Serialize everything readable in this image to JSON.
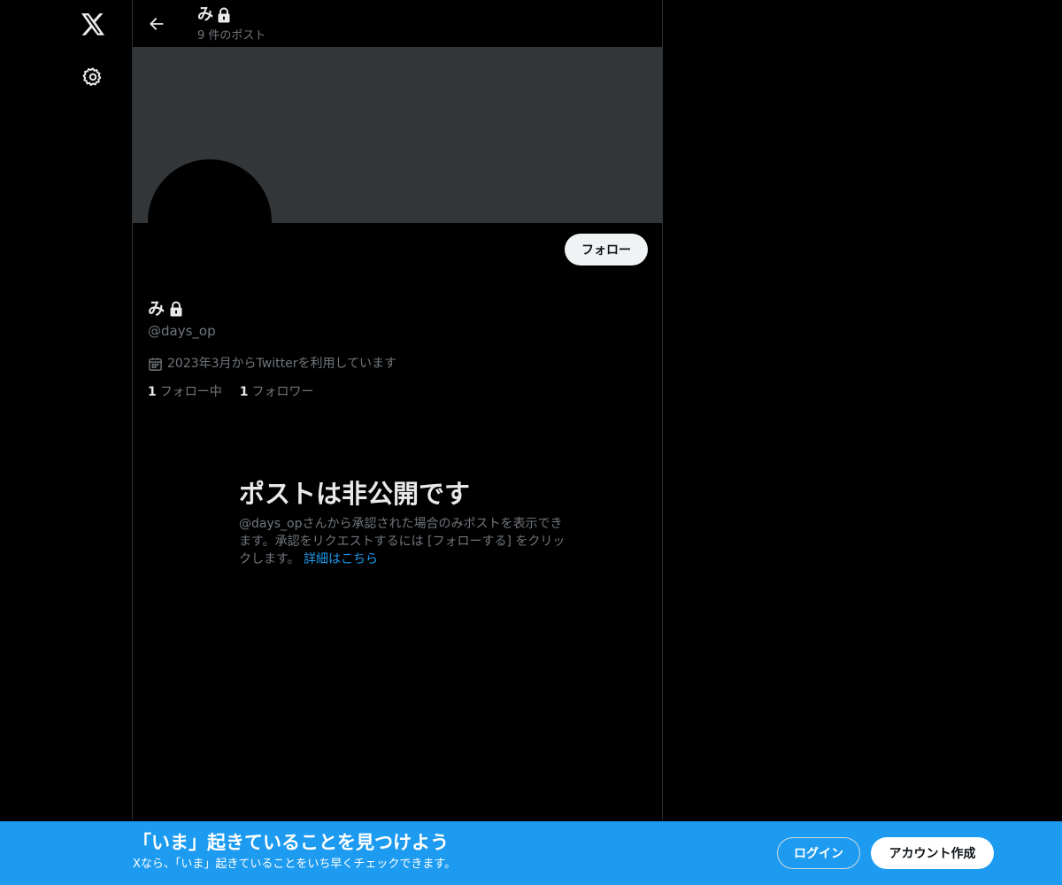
{
  "nav": {
    "logo_icon": "x-logo-icon",
    "settings_icon": "gear-icon"
  },
  "header": {
    "name": "み",
    "post_count": "9 件のポスト",
    "back_icon": "arrow-left-icon",
    "lock_icon": "lock-icon"
  },
  "profile": {
    "follow_label": "フォロー",
    "name": "み",
    "handle": "@days_op",
    "joined": "2023年3月からTwitterを利用しています",
    "following_count": "1",
    "following_label": "フォロー中",
    "followers_count": "1",
    "followers_label": "フォロワー"
  },
  "private_notice": {
    "title": "ポストは非公開です",
    "body": "@days_opさんから承認された場合のみポストを表示できます。承認をリクエストするには [フォローする] をクリックします。",
    "link": "詳細はこちら"
  },
  "bottom_bar": {
    "title": "「いま」起きていることを見つけよう",
    "subtitle": "Xなら、「いま」起きていることをいち早くチェックできます。",
    "login_label": "ログイン",
    "signup_label": "アカウント作成"
  },
  "colors": {
    "background": "#000000",
    "banner": "#333639",
    "accent": "#1d9bf0",
    "muted_text": "#71767b",
    "border": "#2f3336"
  }
}
